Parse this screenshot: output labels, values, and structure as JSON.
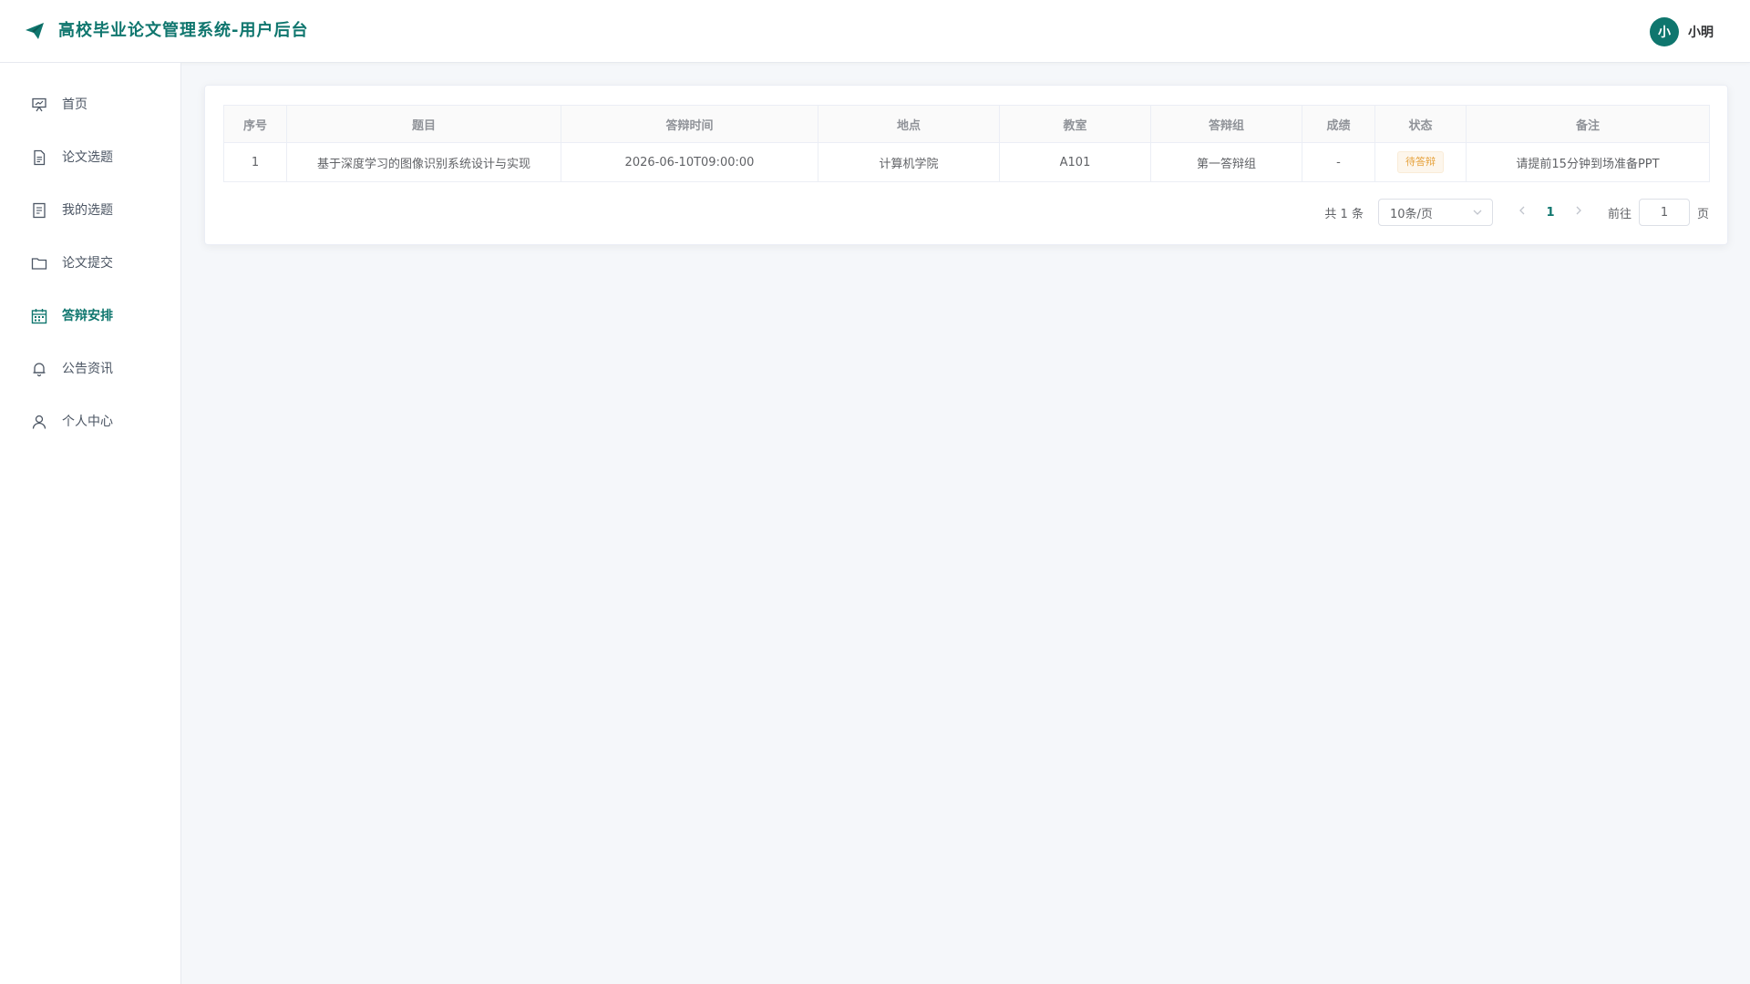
{
  "header": {
    "title": "高校毕业论文管理系统-用户后台",
    "avatar_text": "小",
    "user_name": "小明",
    "logo_icon": "paper-plane-icon",
    "accent_color": "#0f766e"
  },
  "sidebar": {
    "items": [
      {
        "label": "首页",
        "icon": "presentation-icon"
      },
      {
        "label": "论文选题",
        "icon": "document-icon"
      },
      {
        "label": "我的选题",
        "icon": "tickets-icon"
      },
      {
        "label": "论文提交",
        "icon": "folder-icon"
      },
      {
        "label": "答辩安排",
        "icon": "calendar-icon",
        "active": true
      },
      {
        "label": "公告资讯",
        "icon": "bell-icon"
      },
      {
        "label": "个人中心",
        "icon": "user-icon"
      }
    ]
  },
  "table": {
    "columns": [
      "序号",
      "题目",
      "答辩时间",
      "地点",
      "教室",
      "答辩组",
      "成绩",
      "状态",
      "备注"
    ],
    "rows": [
      {
        "index": "1",
        "title": "基于深度学习的图像识别系统设计与实现",
        "time": "2026-06-10T09:00:00",
        "location": "计算机学院",
        "room": "A101",
        "group": "第一答辩组",
        "score": "-",
        "status": "待答辩",
        "remark": "请提前15分钟到场准备PPT"
      }
    ]
  },
  "pagination": {
    "total_text": "共 1 条",
    "page_size": "10条/页",
    "current_page": "1",
    "goto_label": "前往",
    "goto_value": "1",
    "page_unit": "页"
  }
}
